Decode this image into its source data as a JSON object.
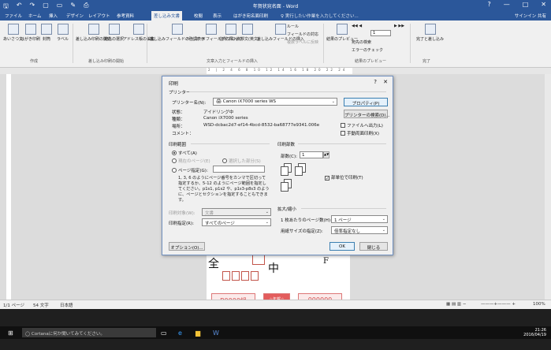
{
  "window": {
    "title": "年賀状宛名面 - Word",
    "qat_icons": [
      "save-icon",
      "undo-icon",
      "redo-icon",
      "new-doc-icon",
      "open-icon",
      "edit-icon",
      "print-preview-icon"
    ],
    "controls": [
      "?",
      "—",
      "□",
      "✕"
    ]
  },
  "tabs": {
    "items": [
      "ファイル",
      "ホーム",
      "挿入",
      "デザイン",
      "レイアウト",
      "参考資料",
      "差し込み文書",
      "校閲",
      "表示",
      "はがき宛名面印刷"
    ],
    "active": "差し込み文書",
    "search_placeholder": "♀ 実行したい作業を入力してください...",
    "signin": "サインイン",
    "share": "共有"
  },
  "ribbon": {
    "groups": [
      {
        "label": "作成",
        "buttons": [
          "あいさつ文",
          "はがき印刷",
          "封筒",
          "ラベル"
        ]
      },
      {
        "label": "差し込み印刷の開始",
        "buttons": [
          "差し込み印刷の開始",
          "宛先の選択",
          "アドレス帳の編集"
        ]
      },
      {
        "label": "文章入力とフィールドの挿入",
        "buttons": [
          "差し込みフィールドの強調表示",
          "バーコードフィールドの挿入",
          "住所ブロック",
          "挨拶文(英文)",
          "差し込みフィールドの挿入"
        ]
      },
      {
        "label": "結果のプレビュー",
        "buttons": [
          "結果のプレビュー"
        ]
      },
      {
        "label": "完了",
        "buttons": [
          "完了と差し込み"
        ]
      }
    ],
    "small_items": [
      "ルール",
      "フィールドの対応",
      "複数ラベルに反映",
      "宛先の検索",
      "エラーのチェック"
    ],
    "record_number": "1"
  },
  "ruler": {
    "ticks": "2 | 2 4 6 8 10 12 14 16 18 20 22 24"
  },
  "dialog": {
    "title": "印刷",
    "help": "?",
    "close": "✕",
    "printer_section": "プリンター",
    "printer_name_label": "プリンター名(N):",
    "printer_name": "Canon iX7000 series WS",
    "properties_button": "プロパティ(P)",
    "find_printer_button": "プリンターの検索(D)...",
    "status_label": "状態：",
    "status_value": "アイドリング中",
    "type_label": "種類：",
    "type_value": "Canon iX7000 series",
    "location_label": "場所：",
    "location_value": "WSD-dcbac2d7-ef14-4bcd-8532-ba68777e9341.006e",
    "comment_label": "コメント：",
    "print_to_file": "ファイルへ出力(L)",
    "manual_duplex": "手動両面印刷(X)",
    "range_section": "印刷範囲",
    "range_all": "すべて(A)",
    "range_current": "現在のページ(E)",
    "range_selection": "選択した部分(S)",
    "range_pages": "ページ指定(G):",
    "range_help": "1, 3, 6 のようにページ番号をカンマで区切って指定するか、5-12 のようにページ範囲を指定してください。p1s1, p1s2 や、p1s3-p8s3 のように、ページとセクションを指定することもできます。",
    "copies_section": "印刷部数",
    "copies_label": "部数(C):",
    "copies_value": "1",
    "collate_label": "部単位で印刷(T)",
    "print_what_label": "印刷対象(W):",
    "print_what_value": "文書",
    "print_label": "印刷指定(R):",
    "print_value": "すべてのページ",
    "zoom_section": "拡大/縮小",
    "pages_per_sheet_label": "1 枚あたりのページ数(H):",
    "pages_per_sheet_value": "1 ページ",
    "scale_label": "用紙サイズの指定(Z):",
    "scale_value": "倍率指定なし",
    "options_button": "オプション(O)...",
    "ok_button": "OK",
    "cancel_button": "閉じる"
  },
  "page": {
    "char_1": "全",
    "char_2": "中",
    "char_3": "F",
    "box_left": "B0000組",
    "box_mid": "☆年賀☆",
    "box_right": "000000"
  },
  "statusbar": {
    "page": "1/1 ページ",
    "words": "54 文字",
    "language": "日本語",
    "zoom": "100%"
  },
  "taskbar": {
    "search": "Cortanaに何か聞いてみてください。",
    "time": "21:26",
    "date": "2016/04/19"
  },
  "colors": {
    "accent": "#2b579a",
    "arc": "#ffc000",
    "stamp_red": "#d04d4d"
  }
}
